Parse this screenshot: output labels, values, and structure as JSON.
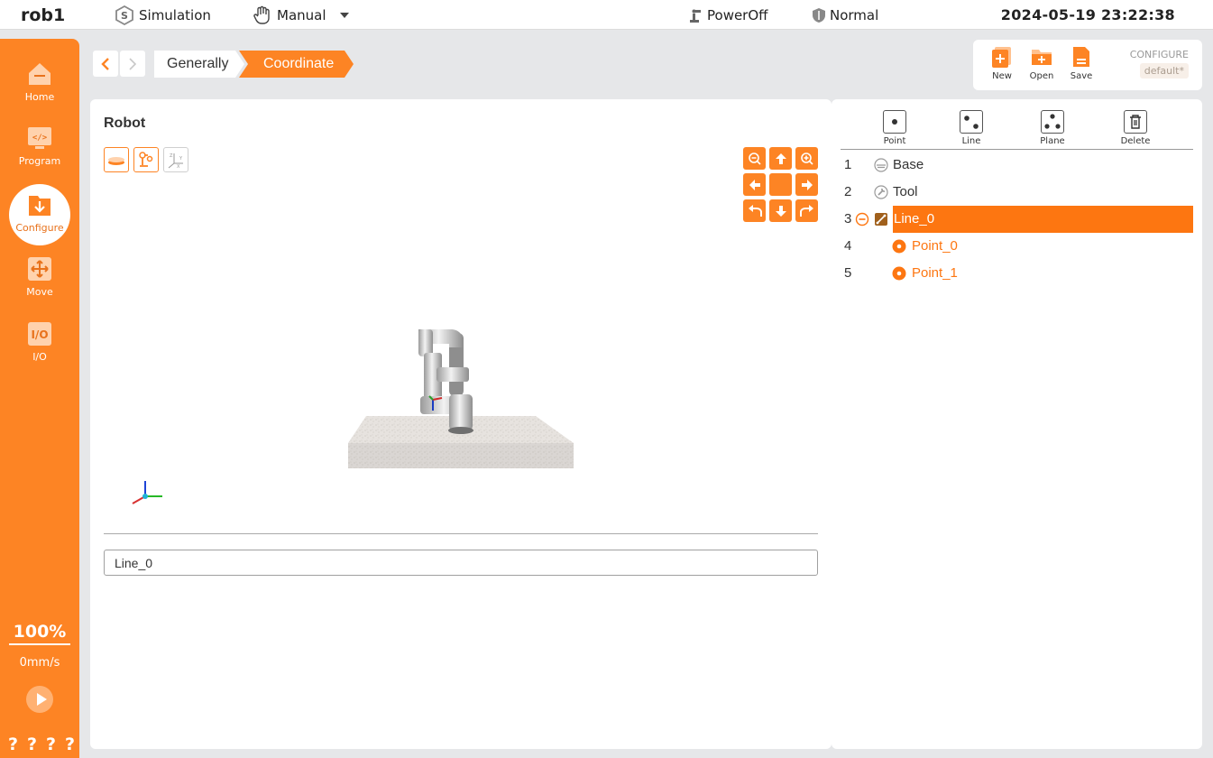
{
  "topbar": {
    "robot_name": "rob1",
    "simulation_label": "Simulation",
    "mode_label": "Manual",
    "power_label": "PowerOff",
    "safety_label": "Normal",
    "datetime": "2024-05-19 23:22:38"
  },
  "sidebar": {
    "items": [
      {
        "label": "Home",
        "icon": "home-icon"
      },
      {
        "label": "Program",
        "icon": "code-icon"
      },
      {
        "label": "Configure",
        "icon": "configure-icon",
        "active": true
      },
      {
        "label": "Move",
        "icon": "move-arrows-icon"
      },
      {
        "label": "I/O",
        "icon": "io-icon"
      }
    ],
    "speed_percent": "100%",
    "speed_mms": "0mm/s",
    "help_marks": [
      "?",
      "?",
      "?",
      "?"
    ]
  },
  "breadcrumb": {
    "items": [
      "Generally",
      "Coordinate"
    ]
  },
  "filebar": {
    "new_label": "New",
    "open_label": "Open",
    "save_label": "Save",
    "config_label": "CONFIGURE",
    "config_value": "default*"
  },
  "main": {
    "title": "Robot",
    "name_input_value": "Line_0"
  },
  "coord_tools": {
    "point_label": "Point",
    "line_label": "Line",
    "plane_label": "Plane",
    "delete_label": "Delete"
  },
  "tree": {
    "rows": [
      {
        "num": "1",
        "label": "Base",
        "icon": "base-icon"
      },
      {
        "num": "2",
        "label": "Tool",
        "icon": "tool-icon"
      },
      {
        "num": "3",
        "label": "Line_0",
        "icon": "line-icon",
        "selected": true
      },
      {
        "num": "4",
        "label": "Point_0",
        "icon": "point-icon"
      },
      {
        "num": "5",
        "label": "Point_1",
        "icon": "point-icon"
      }
    ]
  },
  "colors": {
    "accent": "#fd8424",
    "selected_row": "#fd7611",
    "background": "#e6e7e9"
  }
}
